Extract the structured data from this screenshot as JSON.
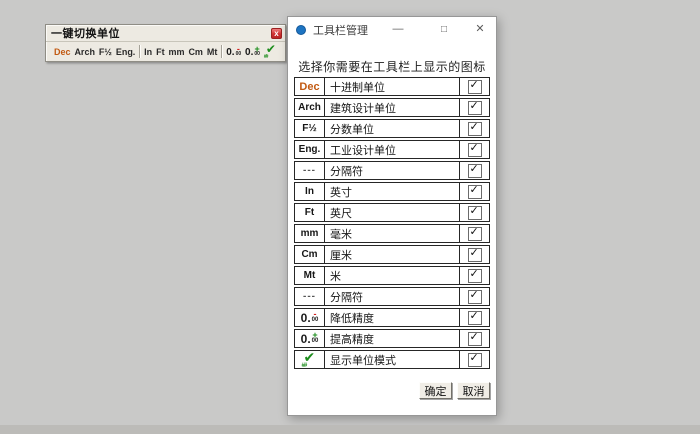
{
  "page": {
    "bg_color": "#c9c9c8",
    "bottom_strip_color": "#bcbbb8"
  },
  "toolbar_window": {
    "title": "一键切换单位",
    "close_icon": "x",
    "buttons": [
      {
        "kind": "text-orange",
        "label": "Dec",
        "name": "decimal-units"
      },
      {
        "kind": "text",
        "label": "Arch",
        "name": "architectural-units"
      },
      {
        "kind": "text",
        "label": "F½",
        "name": "fractional-units"
      },
      {
        "kind": "text",
        "label": "Eng.",
        "name": "engineering-units"
      },
      {
        "kind": "separator"
      },
      {
        "kind": "text",
        "label": "In",
        "name": "inches"
      },
      {
        "kind": "text",
        "label": "Ft",
        "name": "feet"
      },
      {
        "kind": "text",
        "label": "mm",
        "name": "millimeters"
      },
      {
        "kind": "text",
        "label": "Cm",
        "name": "centimeters"
      },
      {
        "kind": "text",
        "label": "Mt",
        "name": "meters"
      },
      {
        "kind": "separator"
      },
      {
        "kind": "prec-minus",
        "name": "decrease-precision"
      },
      {
        "kind": "prec-plus",
        "name": "increase-precision"
      },
      {
        "kind": "check",
        "name": "unit-display-mode"
      }
    ]
  },
  "dialog": {
    "title": "工具栏管理",
    "controls": {
      "minimize": "—",
      "maximize": "□",
      "close": "✕"
    },
    "instruction": "选择你需要在工具栏上显示的图标",
    "rows": [
      {
        "icon_kind": "text-orange",
        "icon_text": "Dec",
        "label": "十进制单位",
        "checked": true
      },
      {
        "icon_kind": "text",
        "icon_text": "Arch",
        "label": "建筑设计单位",
        "checked": true
      },
      {
        "icon_kind": "text",
        "icon_text": "F½",
        "label": "分数单位",
        "checked": true
      },
      {
        "icon_kind": "text",
        "icon_text": "Eng.",
        "label": "工业设计单位",
        "checked": true
      },
      {
        "icon_kind": "separator",
        "icon_text": "---",
        "label": "分隔符",
        "checked": true
      },
      {
        "icon_kind": "text",
        "icon_text": "In",
        "label": "英寸",
        "checked": true
      },
      {
        "icon_kind": "text",
        "icon_text": "Ft",
        "label": "英尺",
        "checked": true
      },
      {
        "icon_kind": "text",
        "icon_text": "mm",
        "label": "毫米",
        "checked": true
      },
      {
        "icon_kind": "text",
        "icon_text": "Cm",
        "label": "厘米",
        "checked": true
      },
      {
        "icon_kind": "text",
        "icon_text": "Mt",
        "label": "米",
        "checked": true
      },
      {
        "icon_kind": "separator",
        "icon_text": "---",
        "label": "分隔符",
        "checked": true
      },
      {
        "icon_kind": "prec-minus",
        "label": "降低精度",
        "checked": true
      },
      {
        "icon_kind": "prec-plus",
        "label": "提高精度",
        "checked": true
      },
      {
        "icon_kind": "check",
        "label": "显示单位模式",
        "checked": true
      }
    ],
    "buttons": {
      "ok": "确定",
      "cancel": "取消"
    }
  },
  "icons": {
    "prec_big": "0.",
    "prec_zeros": "00",
    "prec_minus": "-",
    "prec_plus": "+",
    "check_glyph": "✔",
    "check_hash": "##",
    "checkbox_check": "✓"
  },
  "colors": {
    "accent_orange": "#c25a12",
    "minus_red": "#d42020",
    "plus_green": "#188c18",
    "check_green": "#1b8c1b",
    "dialog_icon_blue": "#1d74c2",
    "close_red": "#d03030"
  }
}
